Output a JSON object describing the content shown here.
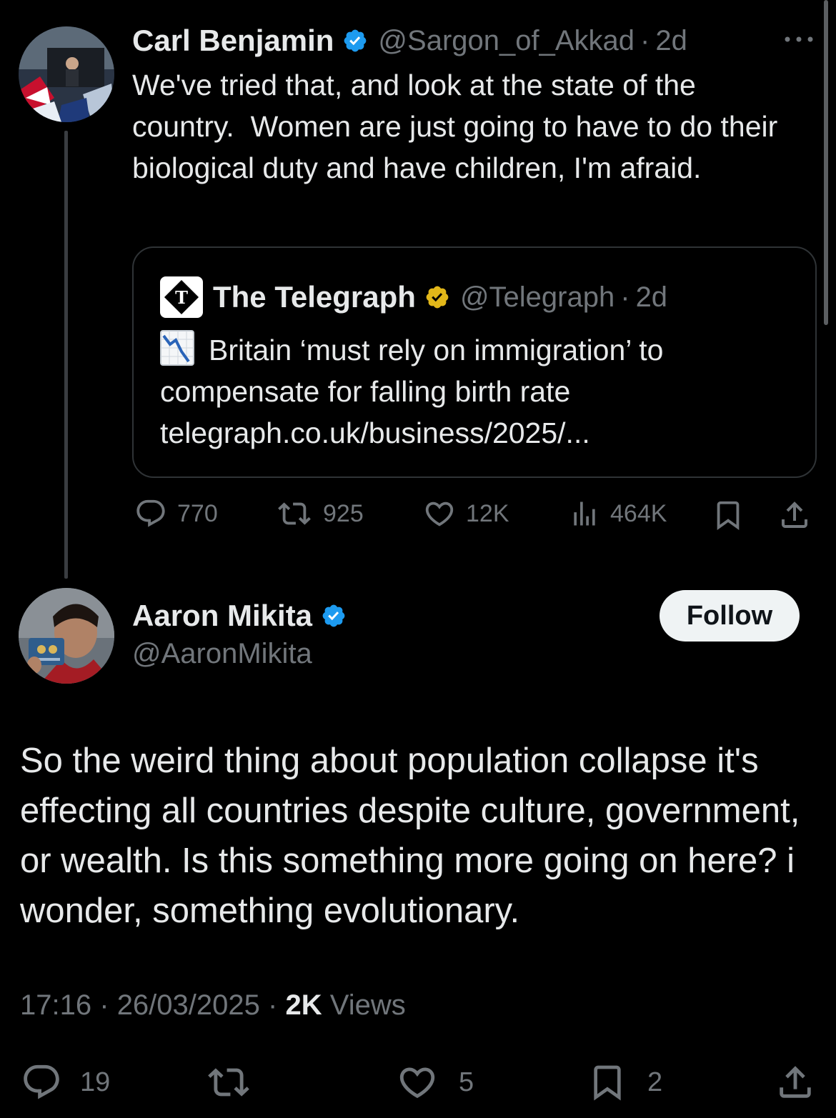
{
  "parent": {
    "name": "Carl Benjamin",
    "handle": "@Sargon_of_Akkad",
    "separator": "·",
    "age": "2d",
    "text": "We've tried that, and look at the state of the country.  Women are just going to have to do their biological duty and have children, I'm afraid.",
    "quote": {
      "name": "The Telegraph",
      "handle": "@Telegraph",
      "separator": "·",
      "age": "2d",
      "headline": "Britain ‘must rely on immigration’ to compensate for falling birth rate",
      "link": "telegraph.co.uk/business/2025/..."
    },
    "stats": {
      "replies": "770",
      "reposts": "925",
      "likes": "12K",
      "views": "464K"
    }
  },
  "main": {
    "name": "Aaron Mikita",
    "handle": "@AaronMikita",
    "follow_label": "Follow",
    "text": "So the weird thing about population collapse it's effecting all countries despite culture, government, or wealth. Is this something more going on here? i wonder, something evolutionary.",
    "time": "17:16",
    "date": "26/03/2025",
    "sep": "·",
    "views_count": "2K",
    "views_label": "Views",
    "stats": {
      "replies": "19",
      "likes": "5",
      "bookmarks": "2"
    }
  },
  "colors": {
    "background": "#000000",
    "text": "#e7e9ea",
    "muted": "#71767b",
    "verified_blue": "#1d9bf0",
    "verified_gold": "#e2b719",
    "border": "#2f3336"
  }
}
